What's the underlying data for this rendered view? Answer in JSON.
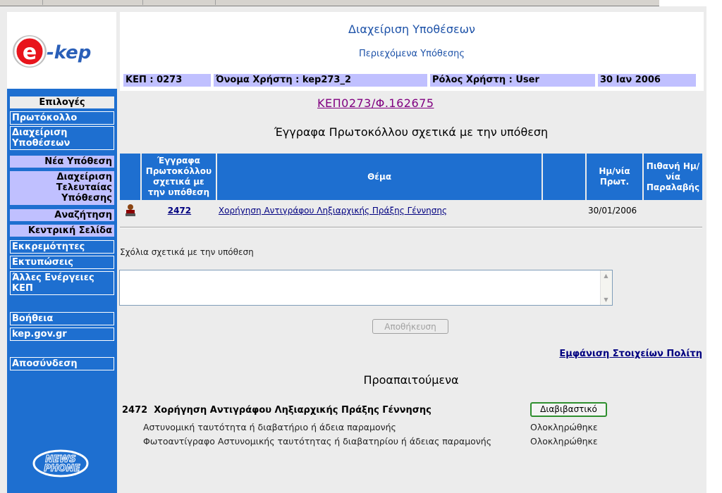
{
  "header": {
    "title": "Διαχείριση Υποθέσεων",
    "subtitle": "Περιεχόμενα Υπόθεσης",
    "kep": "ΚΕΠ : 0273",
    "username": "Όνομα Χρήστη : kep273_2",
    "role": "Ρόλος Χρήστη : User",
    "date": "30 Ιαν 2006"
  },
  "logo": {
    "text": "e-kep",
    "icon": "e-kep-logo"
  },
  "sidebar": {
    "heading": "Επιλογές",
    "items": [
      {
        "label": "Πρωτόκολλο"
      },
      {
        "label": "Διαχείριση Υποθέσεων"
      },
      {
        "label": "Νέα Υπόθεση"
      },
      {
        "label": "Διαχείριση Τελευταίας Υπόθεσης"
      },
      {
        "label": "Αναζήτηση"
      },
      {
        "label": "Κεντρική Σελίδα"
      },
      {
        "label": "Εκκρεμότητες"
      },
      {
        "label": "Εκτυπώσεις"
      },
      {
        "label": "Άλλες Ενέργειες ΚΕΠ"
      },
      {
        "label": "Βοήθεια"
      },
      {
        "label": "kep.gov.gr"
      },
      {
        "label": "Αποσύνδεση"
      }
    ],
    "footer_logo": "NEWSPHONE"
  },
  "case": {
    "link": "ΚΕΠ0273/Φ.162675",
    "section_title": "Έγγραφα Πρωτοκόλλου σχετικά με την υπόθεση"
  },
  "table": {
    "headers": [
      "",
      "Έγγραφα Πρωτοκόλλου σχετικά με την υπόθεση",
      "Θέμα",
      "",
      "Ημ/νία Πρωτ.",
      "Πιθανή Ημ/νία Παραλαβής"
    ],
    "rows": [
      {
        "icon": "user-icon",
        "doc_no": "2472",
        "subject": "Χορήγηση Αντιγράφου Ληξιαρχικής Πράξης Γέννησης",
        "extra": "",
        "prot_date": "30/01/2006",
        "receipt_date": ""
      }
    ]
  },
  "comments": {
    "label": "Σχόλια σχετικά με την υπόθεση",
    "value": "",
    "save_label": "Αποθήκευση"
  },
  "citizen_link": "Εμφάνιση Στοιχείων Πολίτη",
  "prereq": {
    "title": "Προαπαιτούμενα",
    "doc_no": "2472",
    "doc_subject": "Χορήγηση Αντιγράφου Ληξιαρχικής Πράξης Γέννησης",
    "transmit_label": "Διαβιβαστικό",
    "items": [
      {
        "label": "Αστυνομική ταυτότητα ή διαβατήριο ή άδεια παραμονής",
        "status": "Ολοκληρώθηκε"
      },
      {
        "label": "Φωτοαντίγραφο Αστυνομικής ταυτότητας ή διαβατηρίου ή άδειας παραμονής",
        "status": "Ολοκληρώθηκε"
      }
    ]
  },
  "colors": {
    "sidebar_bg": "#1e6fd0",
    "lavender": "#c0c0ff",
    "link_blue": "#000080",
    "visited": "#800080",
    "header_blue": "#1d52a8"
  }
}
